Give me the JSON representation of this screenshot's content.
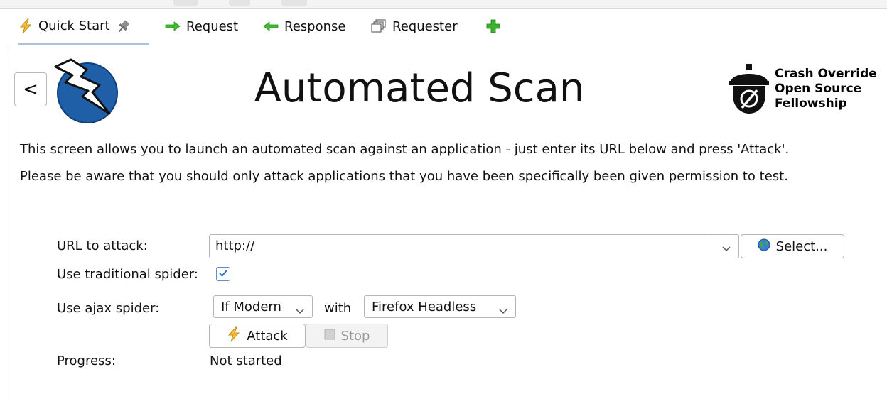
{
  "tabs": [
    {
      "label": "Quick Start",
      "icon": "lightning-icon",
      "active": true
    },
    {
      "label": "Request",
      "icon": "arrow-right-icon"
    },
    {
      "label": "Response",
      "icon": "arrow-left-icon"
    },
    {
      "label": "Requester",
      "icon": "windows-icon"
    }
  ],
  "add_tab_icon": "plus-icon",
  "header": {
    "back_label": "<",
    "title": "Automated Scan",
    "fellowship": {
      "line1": "Crash Override",
      "line2": "Open Source",
      "line3": "Fellowship"
    }
  },
  "description": {
    "line1": "This screen allows you to launch an automated scan against  an application - just enter its URL below and press 'Attack'.",
    "line2": "Please be aware that you should only attack applications that you have been specifically been given permission to test."
  },
  "form": {
    "url_label": "URL to attack:",
    "url_value": "http://",
    "select_label": "Select...",
    "traditional_label": "Use traditional spider:",
    "traditional_checked": true,
    "ajax_label": "Use ajax spider:",
    "ajax_mode": "If Modern",
    "with_label": "with",
    "browser": "Firefox Headless",
    "attack_label": "Attack",
    "stop_label": "Stop",
    "progress_label": "Progress:",
    "progress_value": "Not started"
  },
  "colors": {
    "accent_blue": "#1f5fa8",
    "tab_underline": "#a8c2dc",
    "lightning": "#f3b521",
    "green": "#2ea82e"
  }
}
